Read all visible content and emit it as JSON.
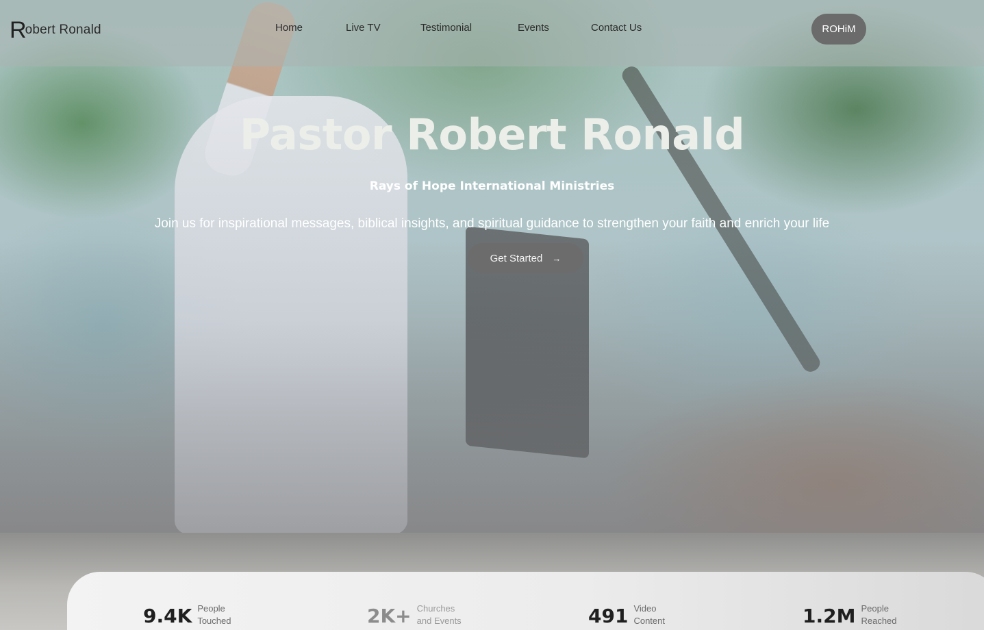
{
  "header": {
    "logo_mark": "R",
    "logo_text": "obert Ronald",
    "nav": [
      "Home",
      "Live TV",
      "Testimonial",
      "Events",
      "Contact Us"
    ],
    "cta_label": "ROHiM"
  },
  "hero": {
    "title": "Pastor Robert Ronald",
    "subtitle": "Rays of Hope International Ministries",
    "description": "Join us for inspirational messages, biblical insights, and spiritual guidance to strengthen your faith and enrich your life",
    "button_label": "Get Started",
    "button_arrow": "→"
  },
  "stats": [
    {
      "value": "9.4K",
      "label_line1": "People",
      "label_line2": "Touched"
    },
    {
      "value": "2K+",
      "label_line1": "Churches",
      "label_line2": "and Events"
    },
    {
      "value": "491",
      "label_line1": "Video",
      "label_line2": "Content"
    },
    {
      "value": "1.2M",
      "label_line1": "People",
      "label_line2": "Reached"
    }
  ],
  "colors": {
    "button_bg": "#6b6b6b",
    "title_text": "#eceee9",
    "stat_number": "#1f1f1f"
  }
}
